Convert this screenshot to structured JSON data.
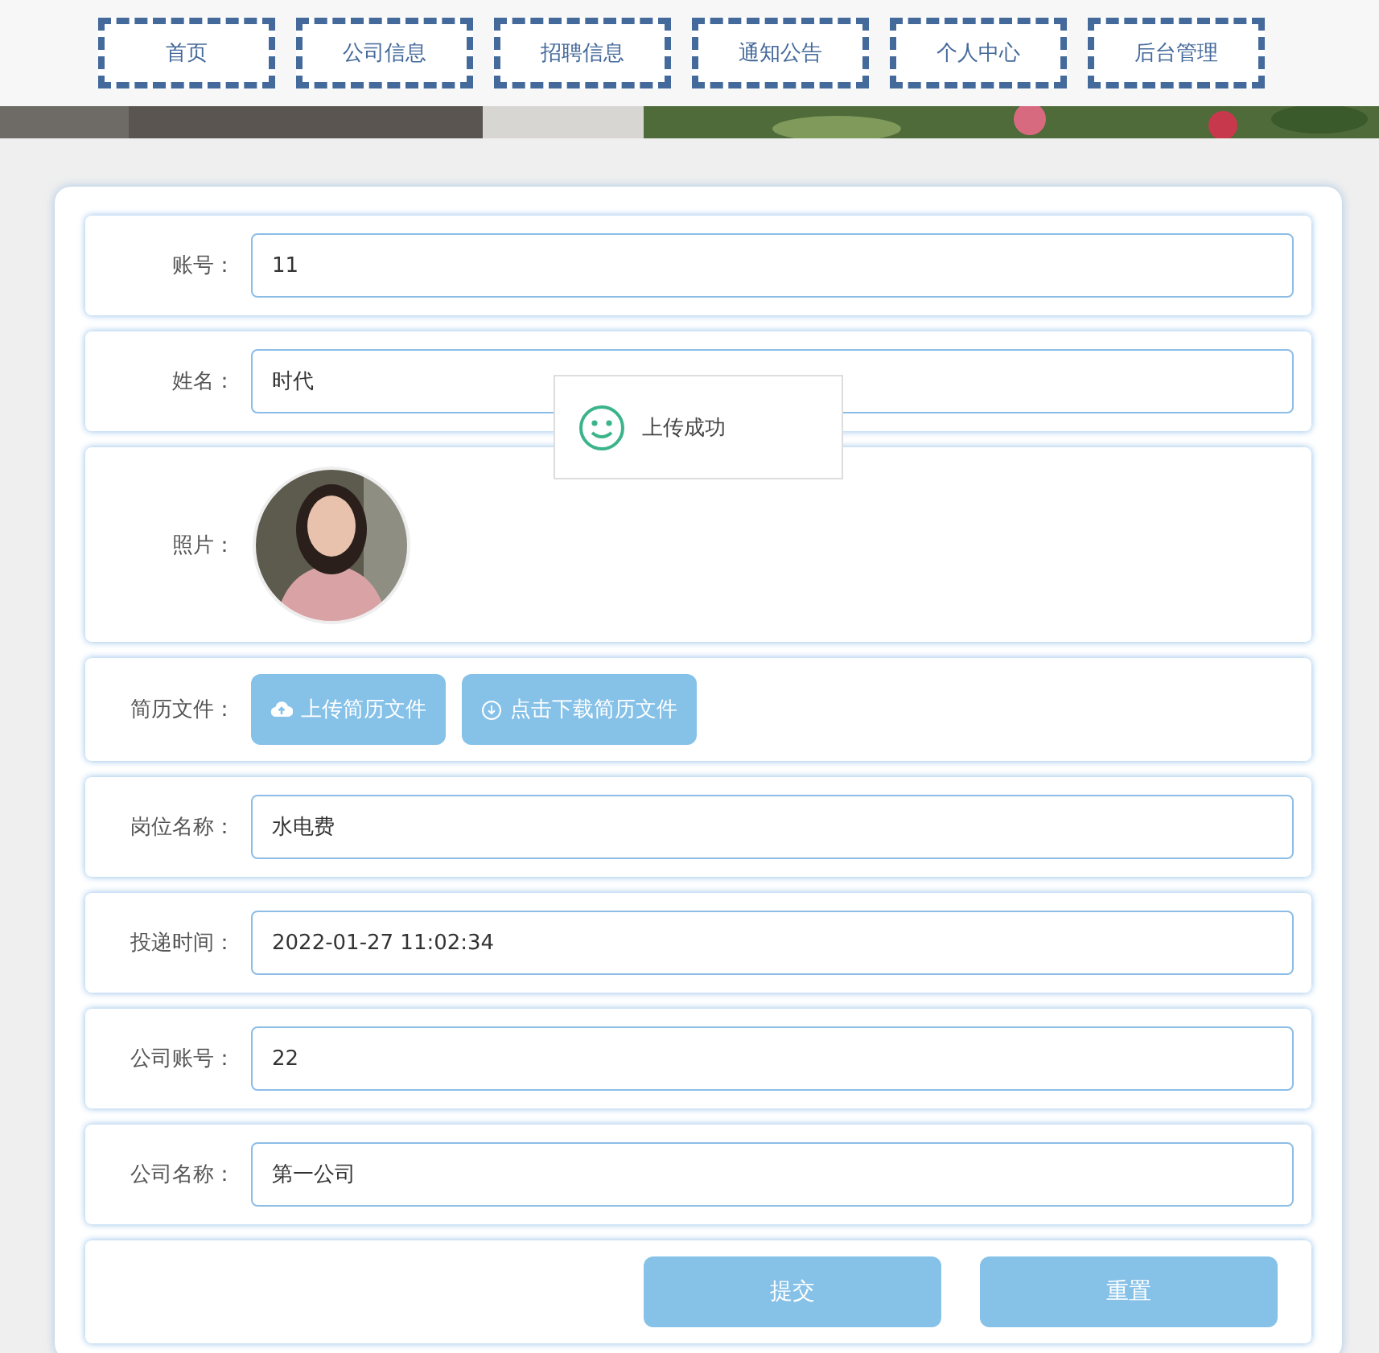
{
  "nav": [
    {
      "label": "首页"
    },
    {
      "label": "公司信息"
    },
    {
      "label": "招聘信息"
    },
    {
      "label": "通知公告"
    },
    {
      "label": "个人中心"
    },
    {
      "label": "后台管理"
    }
  ],
  "form": {
    "rows": [
      {
        "kind": "input",
        "label": "账号：",
        "value": "11"
      },
      {
        "kind": "input",
        "label": "姓名：",
        "value": "时代"
      },
      {
        "label": "照片："
      },
      {
        "kind": "files",
        "label": "简历文件：",
        "buttons": [
          {
            "kind": "upload",
            "label": "上传简历文件"
          },
          {
            "kind": "download",
            "label": "点击下载简历文件"
          }
        ]
      },
      {
        "kind": "input",
        "label": "岗位名称：",
        "value": "水电费"
      },
      {
        "kind": "input",
        "label": "投递时间：",
        "value": "2022-01-27 11:02:34"
      },
      {
        "kind": "input",
        "label": "公司账号：",
        "value": "22"
      },
      {
        "kind": "input",
        "label": "公司名称：",
        "value": "第一公司"
      }
    ],
    "actions": [
      {
        "label": "提交"
      },
      {
        "label": "重置"
      }
    ]
  },
  "toast": {
    "message": "上传成功"
  }
}
